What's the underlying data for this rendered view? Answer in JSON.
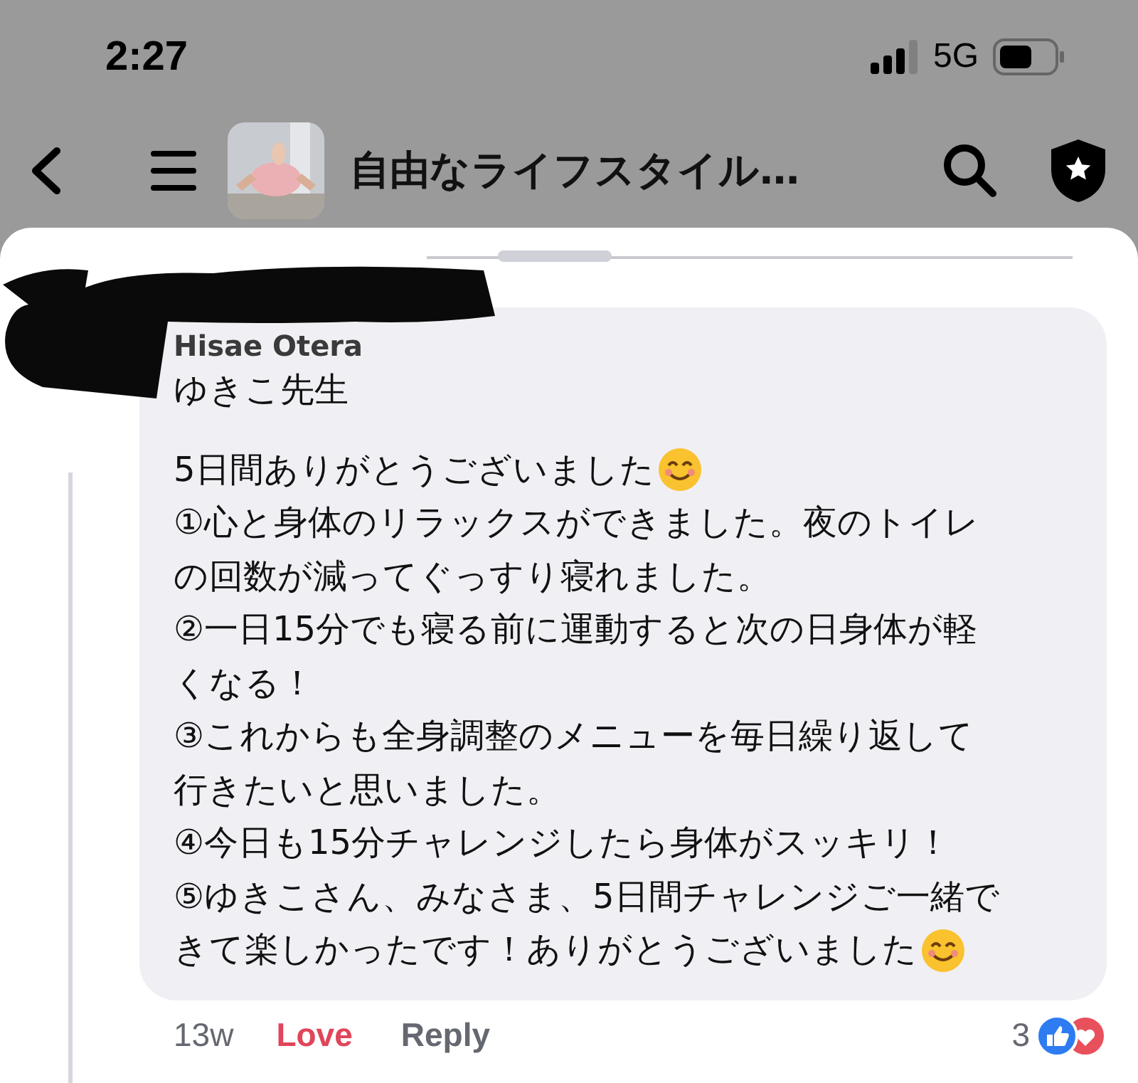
{
  "status_bar": {
    "time": "2:27",
    "network": "5G"
  },
  "header": {
    "title": "自由なライフスタイル…"
  },
  "comment": {
    "author": "Hisae Otera",
    "greeting": "ゆきこ先生",
    "lines": [
      {
        "text": "5日間ありがとうございました",
        "emoji": true
      },
      {
        "text": "①心と身体のリラックスができました。夜のトイレ",
        "emoji": false
      },
      {
        "text": "の回数が減ってぐっすり寝れました。",
        "emoji": false
      },
      {
        "text": "②一日15分でも寝る前に運動すると次の日身体が軽",
        "emoji": false
      },
      {
        "text": "くなる！",
        "emoji": false
      },
      {
        "text": "③これからも全身調整のメニューを毎日繰り返して",
        "emoji": false
      },
      {
        "text": "行きたいと思いました。",
        "emoji": false
      },
      {
        "text": "④今日も15分チャレンジしたら身体がスッキリ！",
        "emoji": false
      },
      {
        "text": "⑤ゆきこさん、みなさま、5日間チャレンジご一緒で",
        "emoji": false
      },
      {
        "text": "きて楽しかったです！ありがとうございました",
        "emoji": true
      }
    ],
    "time": "13w",
    "reaction": "Love",
    "reply": "Reply",
    "reaction_count": "3"
  }
}
